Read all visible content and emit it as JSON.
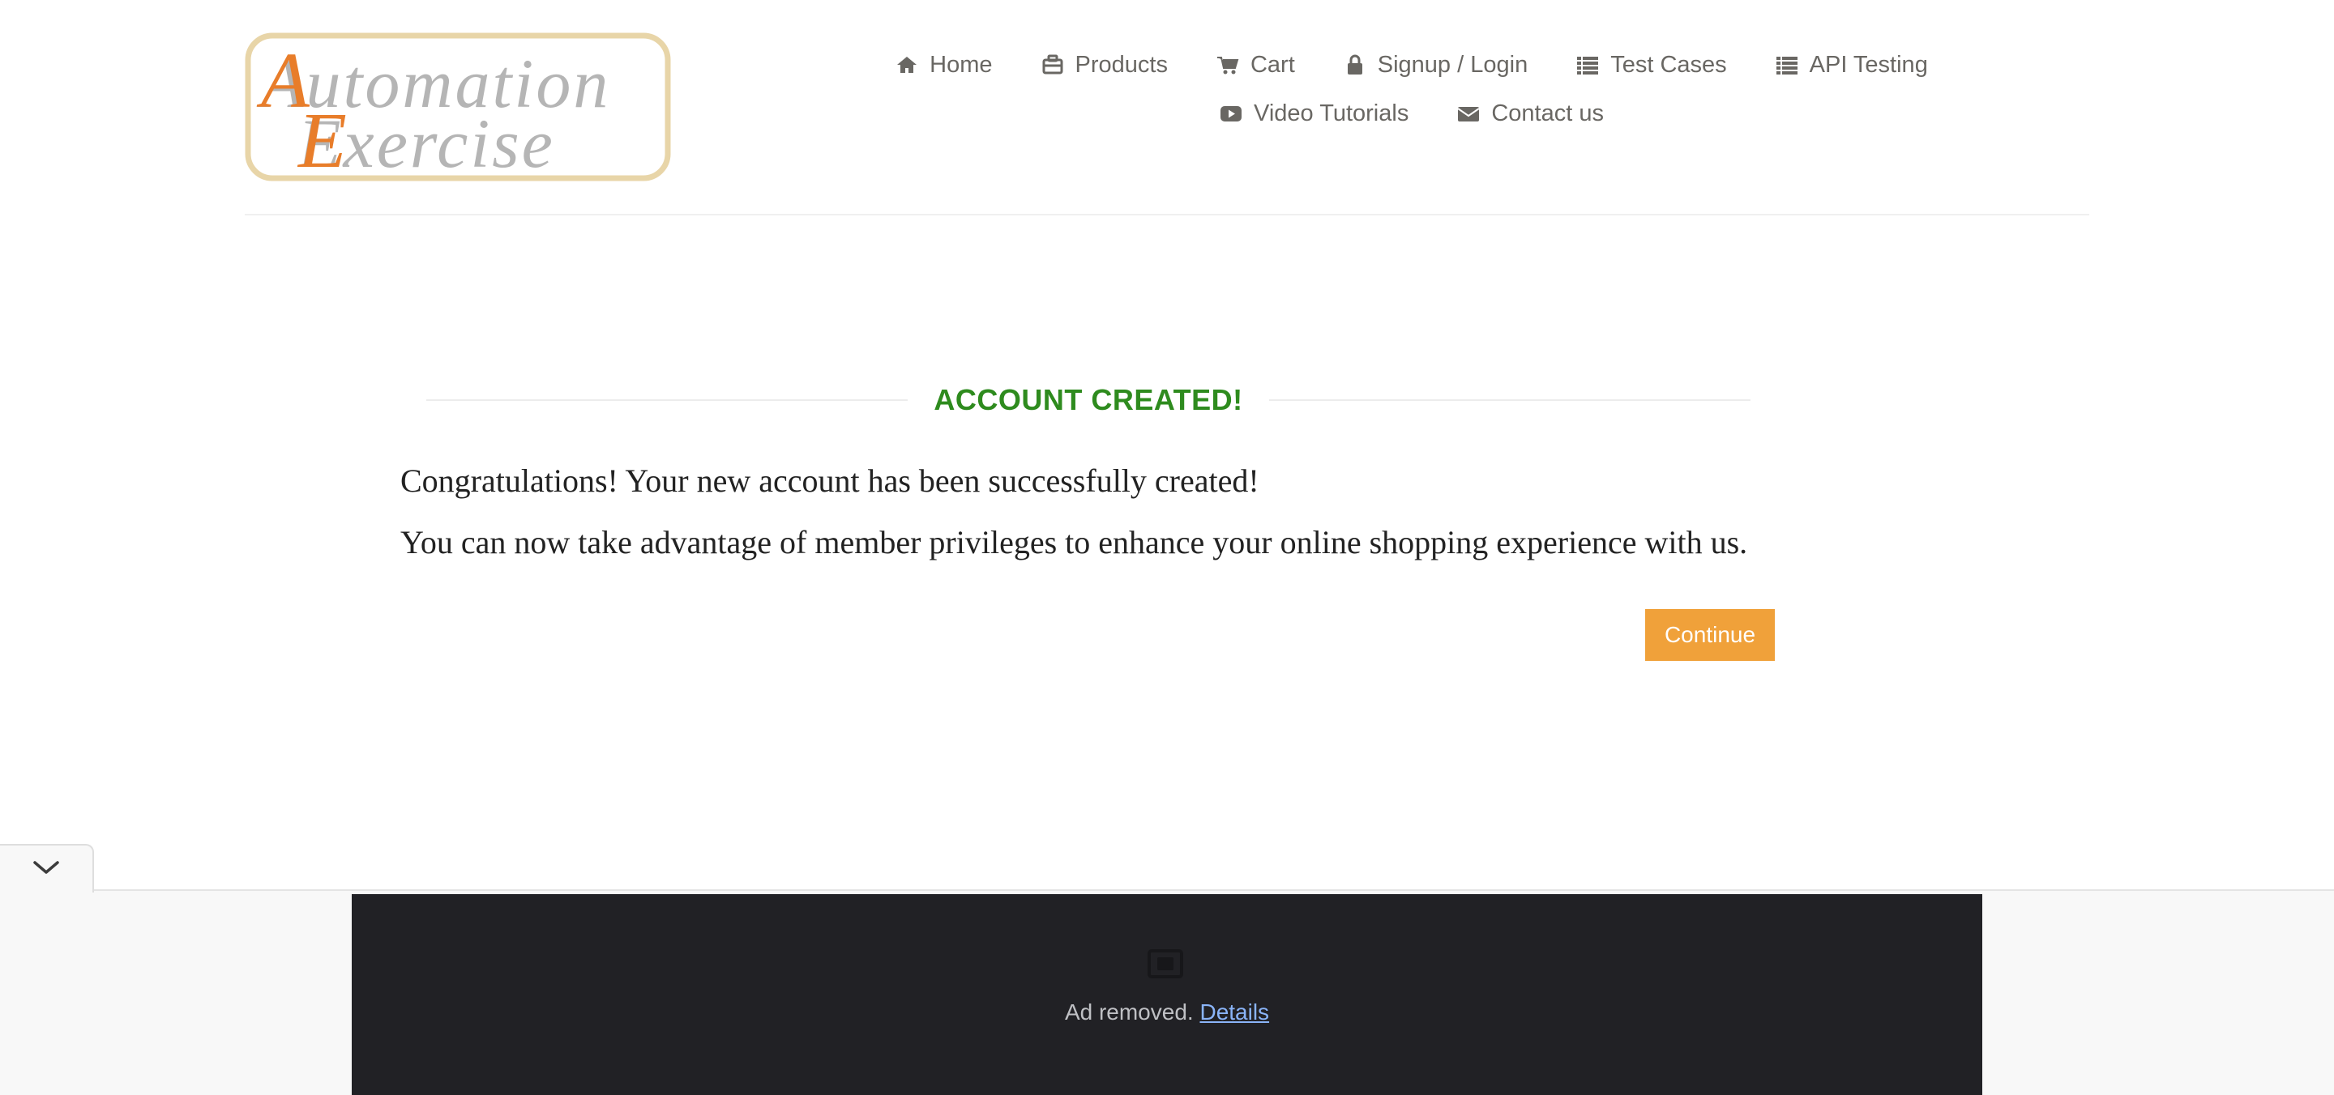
{
  "logo": {
    "line1": "Automation",
    "line2": "Exercise"
  },
  "nav": {
    "row1": [
      {
        "label": "Home",
        "icon": "home-icon"
      },
      {
        "label": "Products",
        "icon": "briefcase-icon"
      },
      {
        "label": "Cart",
        "icon": "cart-icon"
      },
      {
        "label": "Signup / Login",
        "icon": "lock-icon"
      },
      {
        "label": "Test Cases",
        "icon": "list-icon"
      },
      {
        "label": "API Testing",
        "icon": "list-icon"
      }
    ],
    "row2": [
      {
        "label": "Video Tutorials",
        "icon": "youtube-play-icon"
      },
      {
        "label": "Contact us",
        "icon": "envelope-icon"
      }
    ]
  },
  "main": {
    "title": "ACCOUNT CREATED!",
    "message1": "Congratulations! Your new account has been successfully created!",
    "message2": "You can now take advantage of member privileges to enhance your online shopping experience with us.",
    "continue_label": "Continue"
  },
  "ad": {
    "text": "Ad removed.",
    "link": "Details"
  },
  "colors": {
    "title_green": "#2e8b1e",
    "button_orange": "#f0a13a",
    "nav_text": "#696763",
    "logo_orange": "#e87d2a",
    "logo_gray": "#b5b5b5",
    "logo_border": "#e8d5a8"
  }
}
